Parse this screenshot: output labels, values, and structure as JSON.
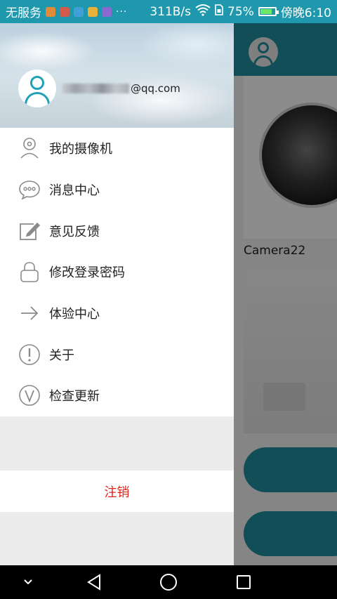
{
  "status_bar": {
    "carrier": "无服务",
    "dots": "···",
    "speed": "311B/s",
    "battery_percent": "75%",
    "time": "傍晚6:10",
    "battery_level": 0.75,
    "icons": [
      "app-icon-1",
      "app-icon-2",
      "app-icon-3",
      "app-icon-4",
      "app-icon-5",
      "wifi-icon",
      "sim-icon",
      "battery-icon"
    ]
  },
  "drawer": {
    "user": {
      "email_visible": "@qq.com",
      "avatar_icon": "user-avatar-icon"
    },
    "menu": [
      {
        "label": "我的摄像机",
        "icon": "camera-icon"
      },
      {
        "label": "消息中心",
        "icon": "message-icon"
      },
      {
        "label": "意见反馈",
        "icon": "feedback-icon"
      },
      {
        "label": "修改登录密码",
        "icon": "lock-icon"
      },
      {
        "label": "体验中心",
        "icon": "arrow-right-icon"
      },
      {
        "label": "关于",
        "icon": "info-icon"
      },
      {
        "label": "检查更新",
        "icon": "update-icon"
      }
    ],
    "logout_label": "注销"
  },
  "main": {
    "camera_name": "Camera22"
  },
  "colors": {
    "accent": "#1f98ad",
    "logout_red": "#e2231a",
    "icon_gray": "#8a8a8a"
  },
  "nav": [
    "chevron-down-icon",
    "back-icon",
    "home-icon",
    "recent-apps-icon"
  ]
}
